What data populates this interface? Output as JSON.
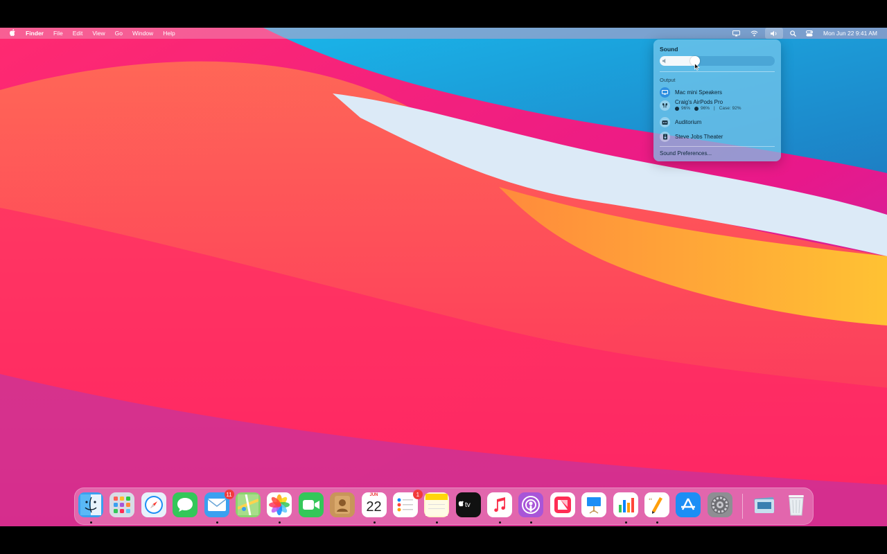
{
  "menubar": {
    "apple_icon": "apple-logo-icon",
    "app_name": "Finder",
    "menus": [
      "File",
      "Edit",
      "View",
      "Go",
      "Window",
      "Help"
    ],
    "status_icons": [
      "screen-mirroring-icon",
      "wifi-icon",
      "volume-icon",
      "spotlight-search-icon",
      "control-center-icon"
    ],
    "clock": "Mon Jun 22  9:41 AM"
  },
  "sound_panel": {
    "title": "Sound",
    "volume_percent": 35,
    "output_label": "Output",
    "devices": [
      {
        "name": "Mac mini Speakers",
        "icon": "display-speaker-icon",
        "selected": true
      },
      {
        "name": "Craig's AirPods Pro",
        "icon": "airpods-icon",
        "selected": false,
        "left": "96%",
        "right": "96%",
        "case": "Case: 92%"
      },
      {
        "name": "Auditorium",
        "icon": "speaker-icon",
        "selected": false
      },
      {
        "name": "Steve Jobs Theater",
        "icon": "speaker-icon",
        "selected": false
      }
    ],
    "prefs_label": "Sound Preferences..."
  },
  "dock": {
    "apps": [
      {
        "name": "Finder",
        "icon": "finder-icon",
        "color": "#3aa0f0",
        "running": true
      },
      {
        "name": "Launchpad",
        "icon": "launchpad-icon",
        "color": "#d8dde6",
        "running": false
      },
      {
        "name": "Safari",
        "icon": "safari-icon",
        "color": "#e8f2fb",
        "running": false
      },
      {
        "name": "Messages",
        "icon": "messages-icon",
        "color": "#34c759",
        "running": false
      },
      {
        "name": "Mail",
        "icon": "mail-icon",
        "color": "#3aa0f0",
        "running": true,
        "badge": "11"
      },
      {
        "name": "Maps",
        "icon": "maps-icon",
        "color": "#8bd36e",
        "running": false
      },
      {
        "name": "Photos",
        "icon": "photos-icon",
        "color": "#ffffff",
        "running": true
      },
      {
        "name": "FaceTime",
        "icon": "facetime-icon",
        "color": "#34c759",
        "running": false
      },
      {
        "name": "Contacts",
        "icon": "contacts-icon",
        "color": "#c8955a",
        "running": false
      },
      {
        "name": "Calendar",
        "icon": "calendar-icon",
        "color": "#ffffff",
        "running": true,
        "month": "JUN",
        "day": "22"
      },
      {
        "name": "Reminders",
        "icon": "reminders-icon",
        "color": "#ffffff",
        "running": false,
        "badge": "1"
      },
      {
        "name": "Notes",
        "icon": "notes-icon",
        "color": "#fff6cc",
        "running": true
      },
      {
        "name": "TV",
        "icon": "apple-tv-icon",
        "color": "#111111",
        "running": false,
        "label": "tv"
      },
      {
        "name": "Music",
        "icon": "music-icon",
        "color": "#ffffff",
        "running": true
      },
      {
        "name": "Podcasts",
        "icon": "podcasts-icon",
        "color": "#a855d8",
        "running": true
      },
      {
        "name": "News",
        "icon": "news-icon",
        "color": "#ffffff",
        "running": false
      },
      {
        "name": "Keynote",
        "icon": "keynote-icon",
        "color": "#ffffff",
        "running": false
      },
      {
        "name": "Numbers",
        "icon": "numbers-icon",
        "color": "#ffffff",
        "running": true
      },
      {
        "name": "Pages",
        "icon": "pages-icon",
        "color": "#ffffff",
        "running": true
      },
      {
        "name": "App Store",
        "icon": "app-store-icon",
        "color": "#1c8ef5",
        "running": false
      },
      {
        "name": "System Preferences",
        "icon": "system-preferences-icon",
        "color": "#8e8e93",
        "running": false
      }
    ],
    "right_items": [
      {
        "name": "Downloads",
        "icon": "downloads-stack-icon",
        "color": "#9fb7c8"
      },
      {
        "name": "Trash",
        "icon": "trash-icon",
        "color": "#eef2f5"
      }
    ]
  }
}
